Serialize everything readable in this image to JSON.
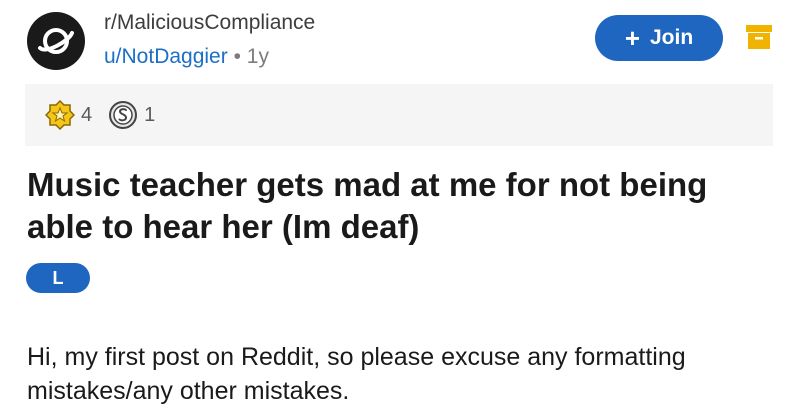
{
  "post": {
    "subreddit": "r/MaliciousCompliance",
    "author": "u/NotDaggier",
    "separator": "•",
    "age": "1y",
    "join_label": "Join",
    "title": "Music teacher gets mad at me for not being able to hear her (Im deaf)",
    "flair": "L",
    "body": "Hi, my first post on Reddit, so please excuse any formatting mistakes/any other mistakes."
  },
  "awards": [
    {
      "icon": "gold-star-award-icon",
      "count": "4"
    },
    {
      "icon": "silver-coin-award-icon",
      "count": "1"
    }
  ],
  "colors": {
    "accent": "#1f66c1",
    "link": "#1c6fc4",
    "menu_icon": "#f0b400"
  }
}
